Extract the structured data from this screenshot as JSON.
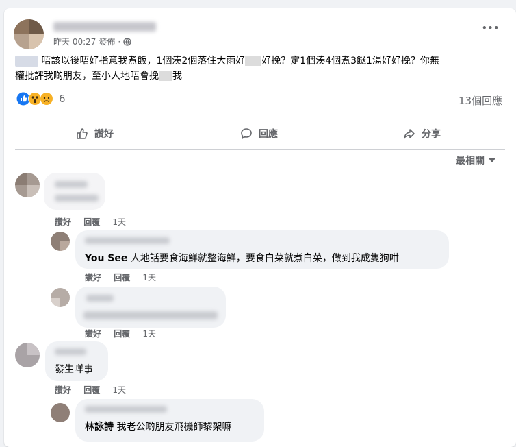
{
  "post": {
    "timestamp": "昨天 00:27",
    "separator": "·",
    "status": "發佈",
    "text_line1_a": "唔該以後唔好指意我煮飯，1個湊2個落住大雨好",
    "text_line1_b": "好挽？定1個湊4個煮3餸1湯好好挽？你無",
    "text_line2_a": "權批評我啲朋友，至小人地唔會挽",
    "text_line2_b": "我",
    "reaction_count": "6",
    "comment_count": "13個回應",
    "more_label": "•••"
  },
  "actions": {
    "like": "讚好",
    "comment": "回應",
    "share": "分享"
  },
  "sort_label": "最相關",
  "comment_actions": {
    "like": "讚好",
    "reply": "回覆",
    "time": "1天"
  },
  "comments": [
    {
      "name": "",
      "text": ""
    },
    {
      "name": "You See",
      "text": "人地話要食海鮮就整海鮮，要食白菜就煮白菜，做到我成隻狗咁"
    },
    {
      "name": "",
      "text": ""
    },
    {
      "name": "",
      "text": "發生咩事"
    },
    {
      "name": "林詠詩",
      "text": "我老公啲朋友飛機師黎架嘛"
    }
  ],
  "colors": {
    "like_blue": "#1877f2",
    "reaction_yellow": "#f7b125",
    "meta_gray": "#65676b",
    "bubble_bg": "#f0f2f5"
  }
}
